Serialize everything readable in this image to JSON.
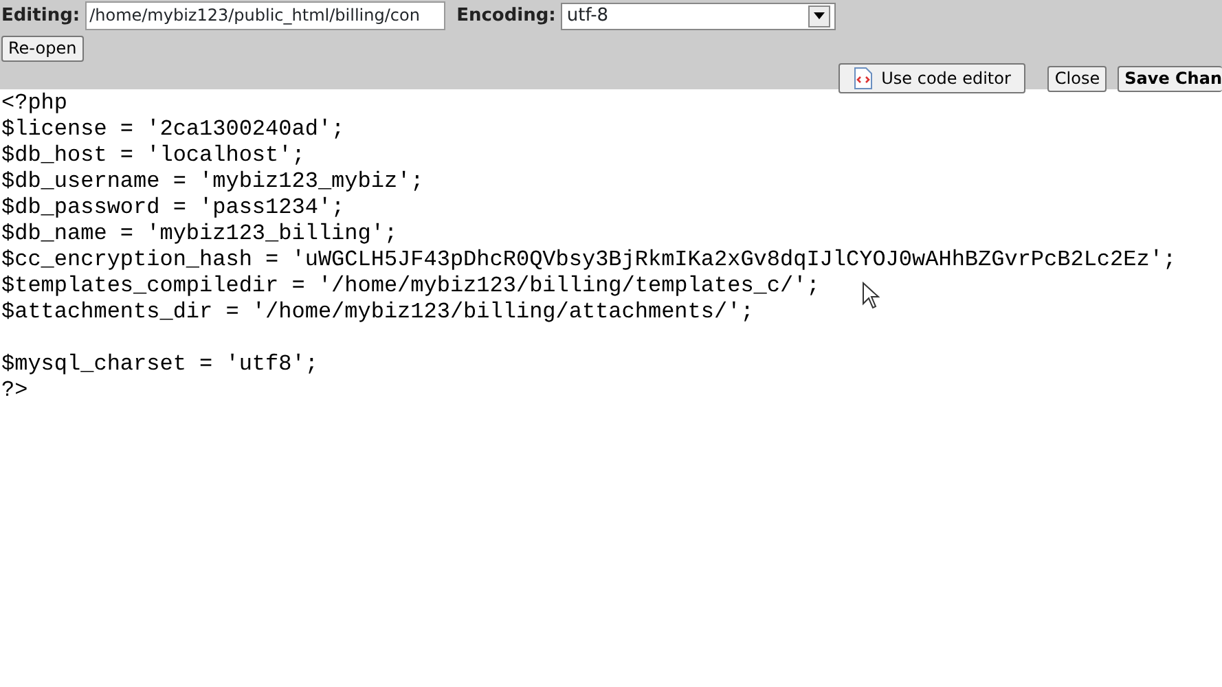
{
  "toolbar": {
    "editing_label": "Editing:",
    "path_value": "/home/mybiz123/public_html/billing/con",
    "encoding_label": "Encoding:",
    "encoding_value": "utf-8",
    "reopen_button": "Re-open",
    "code_editor_button": "Use code editor",
    "close_button": "Close",
    "save_button": "Save Chan"
  },
  "code_lines": [
    {
      "kind": "code",
      "text": "<?php"
    },
    {
      "kind": "code",
      "text": "$license = '2ca1300240ad';"
    },
    {
      "kind": "code",
      "text": "$db_host = 'localhost';"
    },
    {
      "kind": "code",
      "text": "$db_username = 'mybiz123_mybiz';"
    },
    {
      "kind": "code",
      "text": "$db_password = 'pass1234';"
    },
    {
      "kind": "code",
      "text": "$db_name = 'mybiz123_billing';"
    },
    {
      "kind": "code",
      "text": "$cc_encryption_hash = 'uWGCLH5JF43pDhcR0QVbsy3BjRkmIKa2xGv8dqIJlCYOJ0wAHhBZGvrPcB2Lc2Ez';"
    },
    {
      "kind": "code",
      "text": "$templates_compiledir = '/home/mybiz123/billing/templates_c/';"
    },
    {
      "kind": "code",
      "text": "$attachments_dir = '/home/mybiz123/billing/attachments/';"
    },
    {
      "kind": "blank"
    },
    {
      "kind": "code",
      "text": "$mysql_charset = 'utf8';"
    },
    {
      "kind": "code",
      "text": "?>"
    }
  ]
}
